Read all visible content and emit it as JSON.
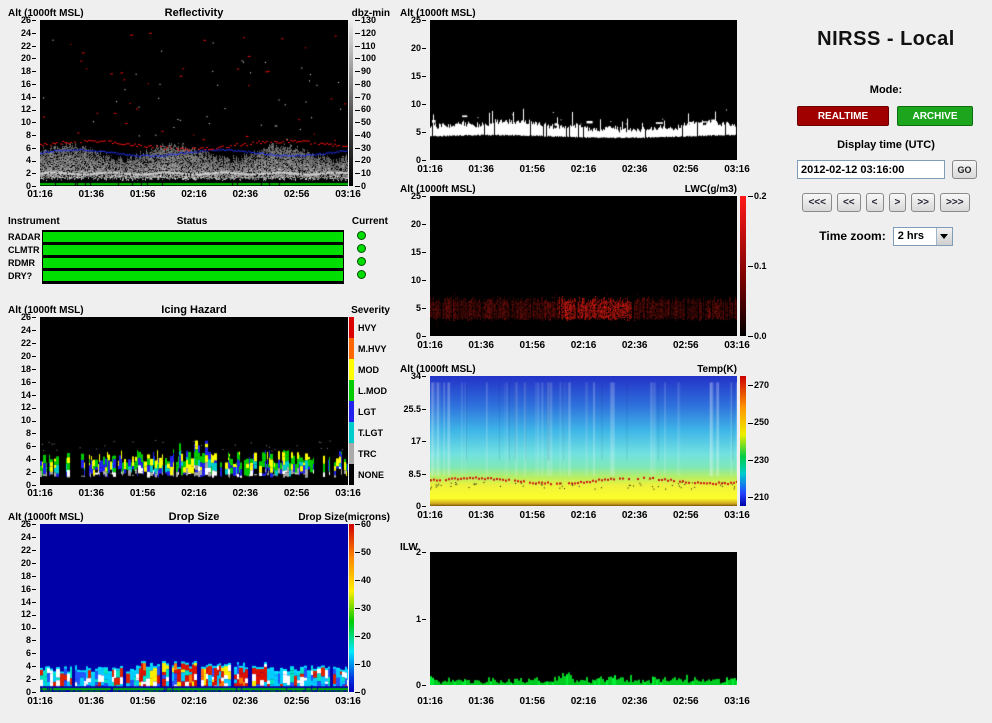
{
  "app": {
    "title": "NIRSS - Local",
    "background": "#efefef"
  },
  "alt_axis_label": "Alt (1000ft MSL)",
  "time_axis": [
    "01:16",
    "01:36",
    "01:56",
    "02:16",
    "02:36",
    "02:56",
    "03:16"
  ],
  "plots": {
    "reflectivity": {
      "title": "Reflectivity",
      "colorbar_label": "dbz-min",
      "yticks": [
        "26",
        "24",
        "22",
        "20",
        "18",
        "16",
        "14",
        "12",
        "10",
        "8",
        "6",
        "4",
        "2",
        "0"
      ],
      "colorbar_ticks": [
        "130",
        "120",
        "110",
        "100",
        "90",
        "80",
        "70",
        "60",
        "50",
        "40",
        "30",
        "20",
        "10",
        "0"
      ]
    },
    "icing": {
      "title": "Icing Hazard",
      "colorbar_label": "Severity",
      "yticks": [
        "26",
        "24",
        "22",
        "20",
        "18",
        "16",
        "14",
        "12",
        "10",
        "8",
        "6",
        "4",
        "2",
        "0"
      ],
      "severity_labels": [
        "HVY",
        "M.HVY",
        "MOD",
        "L.MOD",
        "LGT",
        "T.LGT",
        "TRC",
        "NONE"
      ],
      "severity_colors": [
        "#dd0000",
        "#ff6600",
        "#ffff00",
        "#00cc00",
        "#2222ee",
        "#00cccc",
        "#aaaaaa",
        "#000000"
      ]
    },
    "dropsize": {
      "title": "Drop Size",
      "colorbar_label": "Drop Size(microns)",
      "yticks": [
        "26",
        "24",
        "22",
        "20",
        "18",
        "16",
        "14",
        "12",
        "10",
        "8",
        "6",
        "4",
        "2",
        "0"
      ],
      "colorbar_ticks": [
        "60",
        "50",
        "40",
        "30",
        "20",
        "10",
        "0"
      ]
    },
    "cloud": {
      "yticks": [
        "25",
        "20",
        "15",
        "10",
        "5",
        "0"
      ]
    },
    "lwc": {
      "colorbar_label": "LWC(g/m3)",
      "yticks": [
        "25",
        "20",
        "15",
        "10",
        "5",
        "0"
      ],
      "colorbar_ticks": [
        "0.2",
        "0.1",
        "0.0"
      ]
    },
    "temp": {
      "colorbar_label": "Temp(K)",
      "yticks": [
        "34",
        "25.5",
        "17",
        "8.5",
        "0"
      ],
      "colorbar_ticks": [
        "270",
        "250",
        "230",
        "210"
      ]
    },
    "ilw": {
      "title": "ILW",
      "yticks": [
        "2",
        "1",
        "0"
      ]
    }
  },
  "status_panel": {
    "headers": [
      "Instrument",
      "Status",
      "Current"
    ],
    "rows": [
      "RADAR",
      "CLMTR",
      "RDMR",
      "DRY?"
    ],
    "ok_color": "#00dd00"
  },
  "controls": {
    "mode_label": "Mode:",
    "realtime_button": "REALTIME",
    "realtime_color": "#a00000",
    "archive_button": "ARCHIVE",
    "archive_color": "#1ea51e",
    "display_time_label": "Display time (UTC)",
    "display_time_value": "2012-02-12 03:16:00",
    "go_button": "GO",
    "nav_buttons": [
      "<<<",
      "<<",
      "<",
      ">",
      ">>",
      ">>>"
    ],
    "time_zoom_label": "Time zoom:",
    "time_zoom_value": "2 hrs"
  }
}
